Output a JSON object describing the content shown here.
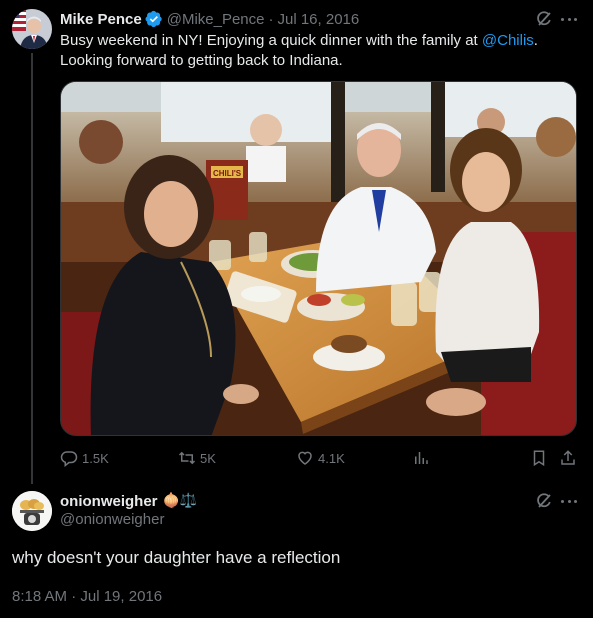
{
  "tweet": {
    "display_name": "Mike Pence",
    "handle": "@Mike_Pence",
    "separator": "·",
    "date": "Jul 16, 2016",
    "text_before": "Busy weekend in NY! Enjoying a quick dinner with the family at ",
    "mention": "@Chilis",
    "text_after": ". Looking forward to getting back to Indiana.",
    "photo_sign_text": "CHILI'S",
    "actions": {
      "replies": "1.5K",
      "retweets": "5K",
      "likes": "4.1K"
    }
  },
  "reply": {
    "display_name": "onionweigher",
    "emojis": "🧅⚖️",
    "handle": "@onionweigher",
    "text": "why doesn't your daughter have a reflection",
    "timestamp": "8:18 AM · Jul 19, 2016"
  },
  "colors": {
    "background": "#000000",
    "text": "#e7e9ea",
    "muted": "#71767b",
    "link": "#1d9bf0",
    "border": "#2f3336"
  },
  "icons": [
    "verified-badge-icon",
    "grok-icon",
    "more-icon",
    "reply-icon",
    "retweet-icon",
    "like-icon",
    "views-icon",
    "bookmark-icon",
    "share-icon"
  ]
}
